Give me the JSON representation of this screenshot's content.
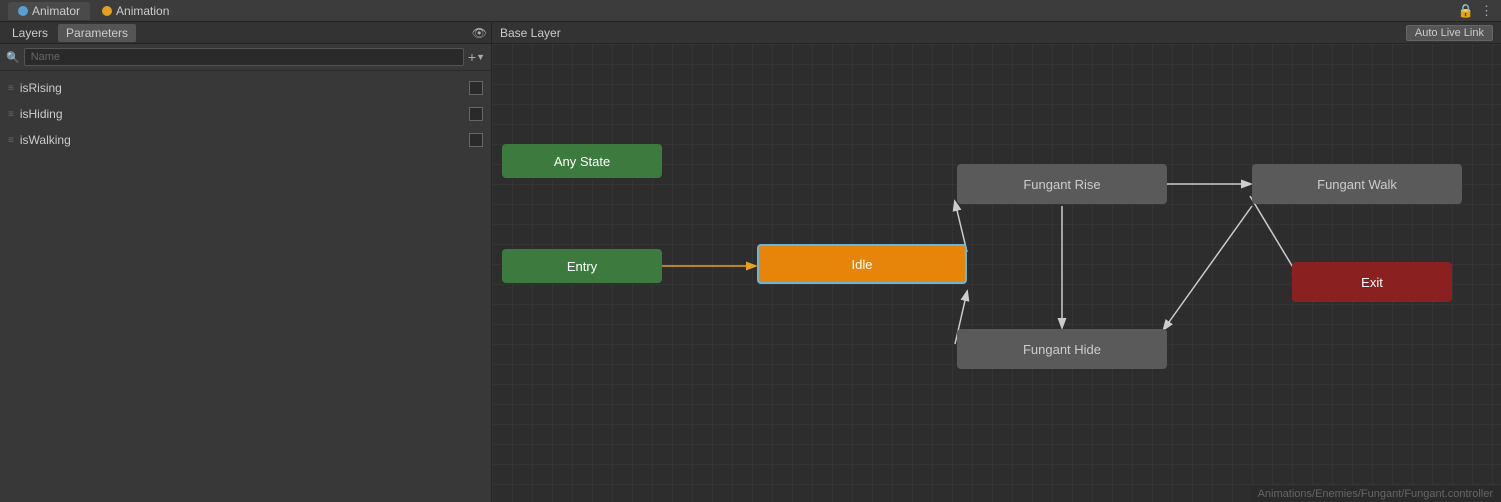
{
  "title_bar": {
    "tabs": [
      {
        "id": "animator",
        "label": "Animator",
        "icon": "blue",
        "active": true
      },
      {
        "id": "animation",
        "label": "Animation",
        "icon": "orange",
        "active": false
      }
    ],
    "lock_icon": "🔒",
    "menu_icon": "⋮"
  },
  "left_panel": {
    "tabs": [
      {
        "id": "layers",
        "label": "Layers",
        "active": false
      },
      {
        "id": "parameters",
        "label": "Parameters",
        "active": true
      }
    ],
    "eye_icon": "👁",
    "search": {
      "placeholder": "Name",
      "icon": "🔍"
    },
    "add_button": "+",
    "parameters": [
      {
        "name": "isRising",
        "value": false
      },
      {
        "name": "isHiding",
        "value": false
      },
      {
        "name": "isWalking",
        "value": false
      }
    ]
  },
  "graph": {
    "breadcrumb": "Base Layer",
    "auto_live_link_label": "Auto Live Link",
    "nodes": {
      "any_state": "Any State",
      "entry": "Entry",
      "idle": "Idle",
      "fungant_rise": "Fungant Rise",
      "fungant_walk": "Fungant Walk",
      "fungant_hide": "Fungant Hide",
      "exit": "Exit"
    },
    "status": "Animations/Enemies/Fungant/Fungant.controller"
  }
}
